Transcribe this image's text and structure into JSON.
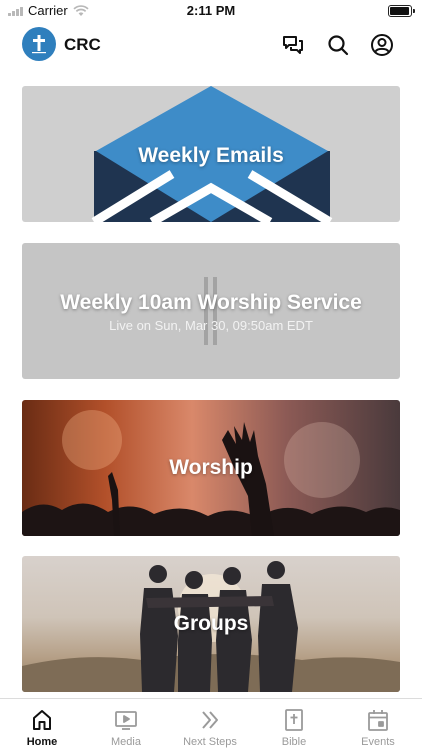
{
  "status_bar": {
    "carrier": "Carrier",
    "time": "2:11 PM",
    "battery_level": 0.95,
    "icons": [
      "signal-icon",
      "wifi-icon",
      "battery-icon"
    ]
  },
  "header": {
    "app_name": "CRC",
    "icons": [
      "logo-cross-icon",
      "chat-icon",
      "search-icon",
      "profile-icon"
    ]
  },
  "cards": [
    {
      "title": "Weekly Emails",
      "subtitle": ""
    },
    {
      "title": "Weekly 10am Worship Service",
      "subtitle": "Live on Sun, Mar 30, 09:50am EDT"
    },
    {
      "title": "Worship",
      "subtitle": ""
    },
    {
      "title": "Groups",
      "subtitle": ""
    }
  ],
  "tab_bar": {
    "active": "Home",
    "tabs": [
      {
        "label": "Home",
        "icon": "home-icon"
      },
      {
        "label": "Media",
        "icon": "media-icon"
      },
      {
        "label": "Next Steps",
        "icon": "chevrons-right-icon"
      },
      {
        "label": "Bible",
        "icon": "bible-icon"
      },
      {
        "label": "Events",
        "icon": "calendar-icon"
      }
    ]
  },
  "colors": {
    "accent": "#2f7fbd",
    "email_blue": "#3e8cc8",
    "email_navy": "#1f3450",
    "tab_inactive": "#9a9a9a"
  }
}
